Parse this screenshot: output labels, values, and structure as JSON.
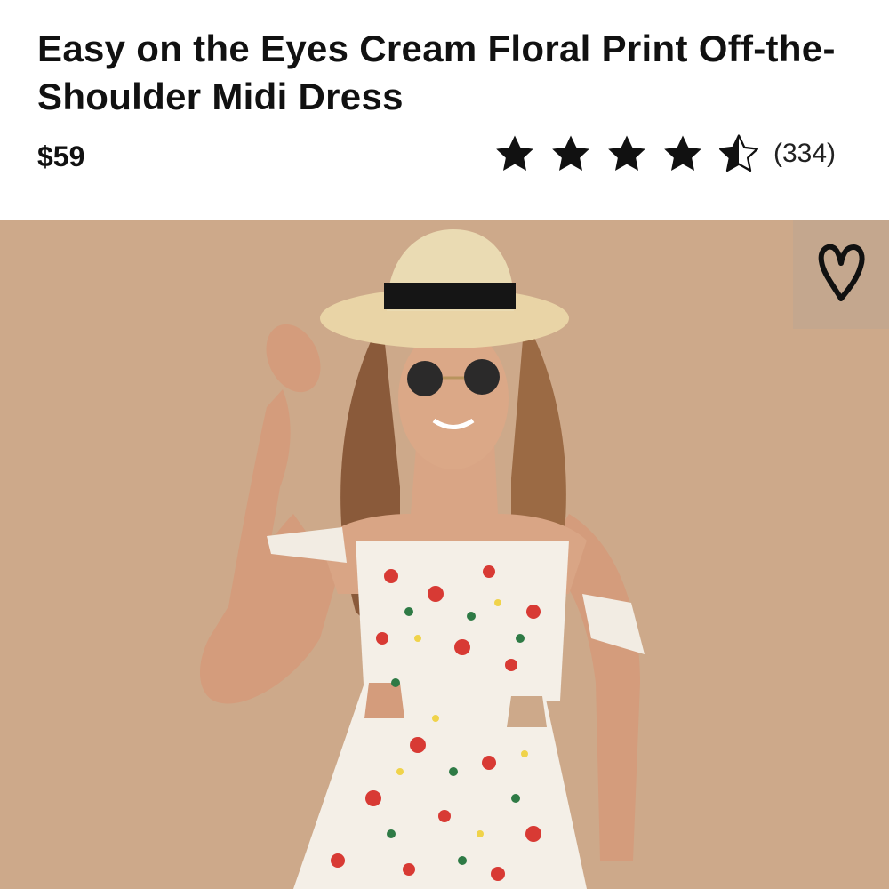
{
  "product": {
    "title": "Easy on the Eyes Cream Floral Print Off-the-Shoulder Midi Dress",
    "price": "$59"
  },
  "rating": {
    "value": 4.5,
    "max": 5,
    "review_count": "(334)",
    "icons": [
      "star-filled",
      "star-filled",
      "star-filled",
      "star-filled",
      "star-half"
    ]
  },
  "image": {
    "background_color": "#cda98a",
    "favorite_icon": "heart-outline-icon"
  }
}
